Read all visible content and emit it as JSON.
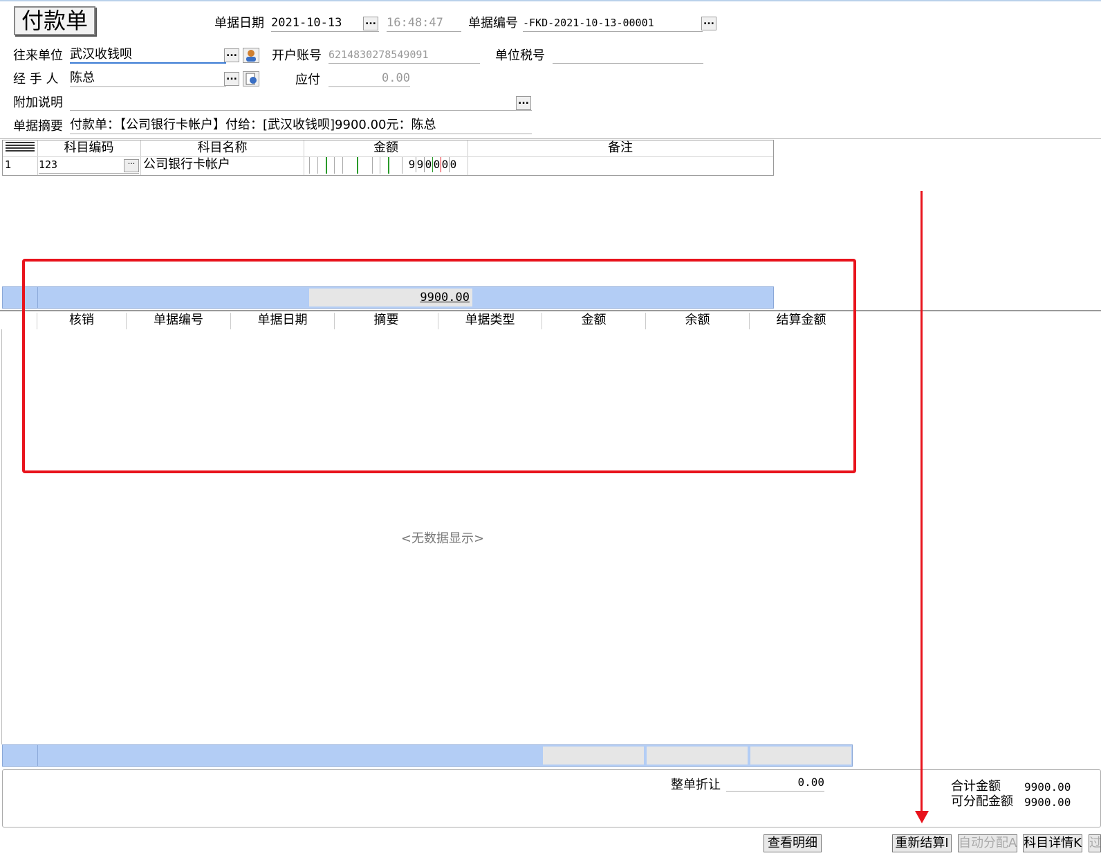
{
  "form": {
    "title": "付款单",
    "date_label": "单据日期",
    "date_value": "2021-10-13",
    "time_value": "16:48:47",
    "number_label": "单据编号",
    "number_value": "-FKD-2021-10-13-00001",
    "partner_label": "往来单位",
    "partner_value": "武汉收钱呗",
    "account_label": "开户账号",
    "account_value": "6214830278549091",
    "taxno_label": "单位税号",
    "taxno_value": "",
    "handler_label": "经 手 人",
    "handler_value": "陈总",
    "payable_label": "应付",
    "payable_value": "0.00",
    "note_label": "附加说明",
    "note_value": "",
    "summary_label": "单据摘要",
    "summary_value": "付款单：【公司银行卡帐户】付给：[武汉收钱呗]9900.00元：陈总"
  },
  "upper_grid": {
    "headers": [
      "科目编码",
      "科目名称",
      "金额",
      "备注"
    ],
    "rows": [
      {
        "index": "1",
        "code": "123",
        "name": "公司银行卡帐户",
        "amount_digits": [
          "9",
          "9",
          "0",
          "0",
          "0",
          "0"
        ],
        "note": ""
      }
    ],
    "total": "9900.00"
  },
  "lower_grid": {
    "headers": [
      "核销",
      "单据编号",
      "单据日期",
      "摘要",
      "单据类型",
      "金额",
      "余额",
      "结算金额"
    ],
    "empty_text": "<无数据显示>"
  },
  "footer": {
    "discount_label": "整单折让",
    "discount_value": "0.00",
    "total_label": "合计金额",
    "total_value": "9900.00",
    "allocatable_label": "可分配金额",
    "allocatable_value": "9900.00"
  },
  "buttons": {
    "view_detail": "查看明细",
    "recalc": "重新结算I",
    "auto_alloc": "自动分配A",
    "subject_detail": "科目详情K",
    "more": "过"
  },
  "colors": {
    "annotation_red": "#e8131c",
    "grid_blue": "#b3cdf5"
  }
}
